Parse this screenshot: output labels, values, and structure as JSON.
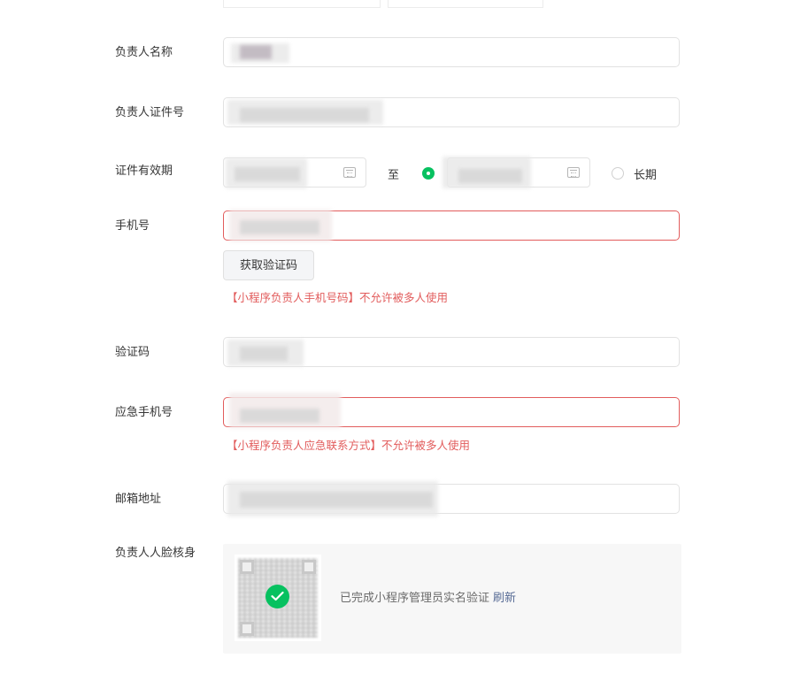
{
  "form": {
    "owner_name_label": "负责人名称",
    "owner_id_label": "负责人证件号",
    "id_validity_label": "证件有效期",
    "to_label": "至",
    "long_term_label": "长期",
    "phone_label": "手机号",
    "get_code_button": "获取验证码",
    "phone_error": "【小程序负责人手机号码】不允许被多人使用",
    "code_label": "验证码",
    "emergency_phone_label": "应急手机号",
    "emergency_phone_error": "【小程序负责人应急联系方式】不允许被多人使用",
    "email_label": "邮箱地址",
    "face_verify_label": "负责人人脸核身",
    "face_verify_status": "已完成小程序管理员实名验证",
    "refresh_link": "刷新"
  },
  "colors": {
    "accent_green": "#07c160",
    "error_red": "#e25c5c",
    "link_blue": "#576b95"
  },
  "icons": [
    "calendar-icon",
    "check-icon",
    "qr-code-icon"
  ]
}
